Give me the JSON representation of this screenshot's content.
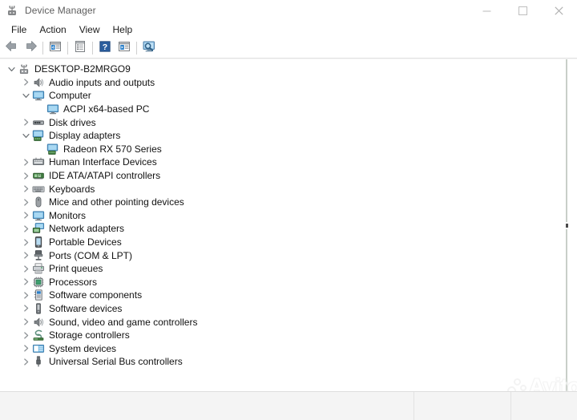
{
  "window": {
    "title": "Device Manager",
    "icon": "device-manager-icon",
    "controls": [
      {
        "name": "minimize-button",
        "glyph": "minimize"
      },
      {
        "name": "maximize-button",
        "glyph": "maximize"
      },
      {
        "name": "close-button",
        "glyph": "close"
      }
    ]
  },
  "menubar": {
    "items": [
      {
        "label": "File"
      },
      {
        "label": "Action"
      },
      {
        "label": "View"
      },
      {
        "label": "Help"
      }
    ]
  },
  "toolbar": {
    "buttons": [
      {
        "name": "back-button",
        "icon": "back-arrow-icon"
      },
      {
        "name": "forward-button",
        "icon": "forward-arrow-icon"
      },
      {
        "name": "separator-1",
        "icon": "separator"
      },
      {
        "name": "show-hide-console-tree-button",
        "icon": "console-tree-icon"
      },
      {
        "name": "separator-2",
        "icon": "separator"
      },
      {
        "name": "properties-button",
        "icon": "properties-icon"
      },
      {
        "name": "separator-3",
        "icon": "separator"
      },
      {
        "name": "help-button",
        "icon": "help-icon"
      },
      {
        "name": "update-driver-button",
        "icon": "update-driver-icon"
      },
      {
        "name": "separator-4",
        "icon": "separator"
      },
      {
        "name": "scan-for-hardware-changes-button",
        "icon": "scan-hardware-icon"
      }
    ]
  },
  "tree": {
    "nodes": [
      {
        "label": "DESKTOP-B2MRGO9",
        "depth": 0,
        "state": "expanded",
        "icon": "computer-root-icon"
      },
      {
        "label": "Audio inputs and outputs",
        "depth": 1,
        "state": "collapsed",
        "icon": "speaker-icon"
      },
      {
        "label": "Computer",
        "depth": 1,
        "state": "expanded",
        "icon": "monitor-icon"
      },
      {
        "label": "ACPI x64-based PC",
        "depth": 2,
        "state": "leaf",
        "icon": "monitor-icon"
      },
      {
        "label": "Disk drives",
        "depth": 1,
        "state": "collapsed",
        "icon": "disk-drive-icon"
      },
      {
        "label": "Display adapters",
        "depth": 1,
        "state": "expanded",
        "icon": "display-adapter-icon"
      },
      {
        "label": "Radeon RX 570 Series",
        "depth": 2,
        "state": "leaf",
        "icon": "display-adapter-icon"
      },
      {
        "label": "Human Interface Devices",
        "depth": 1,
        "state": "collapsed",
        "icon": "hid-icon"
      },
      {
        "label": "IDE ATA/ATAPI controllers",
        "depth": 1,
        "state": "collapsed",
        "icon": "ide-controller-icon"
      },
      {
        "label": "Keyboards",
        "depth": 1,
        "state": "collapsed",
        "icon": "keyboard-icon"
      },
      {
        "label": "Mice and other pointing devices",
        "depth": 1,
        "state": "collapsed",
        "icon": "mouse-icon"
      },
      {
        "label": "Monitors",
        "depth": 1,
        "state": "collapsed",
        "icon": "monitor-icon"
      },
      {
        "label": "Network adapters",
        "depth": 1,
        "state": "collapsed",
        "icon": "network-adapter-icon"
      },
      {
        "label": "Portable Devices",
        "depth": 1,
        "state": "collapsed",
        "icon": "portable-device-icon"
      },
      {
        "label": "Ports (COM & LPT)",
        "depth": 1,
        "state": "collapsed",
        "icon": "port-icon"
      },
      {
        "label": "Print queues",
        "depth": 1,
        "state": "collapsed",
        "icon": "printer-icon"
      },
      {
        "label": "Processors",
        "depth": 1,
        "state": "collapsed",
        "icon": "processor-icon"
      },
      {
        "label": "Software components",
        "depth": 1,
        "state": "collapsed",
        "icon": "software-component-icon"
      },
      {
        "label": "Software devices",
        "depth": 1,
        "state": "collapsed",
        "icon": "software-device-icon"
      },
      {
        "label": "Sound, video and game controllers",
        "depth": 1,
        "state": "collapsed",
        "icon": "speaker-icon"
      },
      {
        "label": "Storage controllers",
        "depth": 1,
        "state": "collapsed",
        "icon": "storage-controller-icon"
      },
      {
        "label": "System devices",
        "depth": 1,
        "state": "collapsed",
        "icon": "system-device-icon"
      },
      {
        "label": "Universal Serial Bus controllers",
        "depth": 1,
        "state": "collapsed",
        "icon": "usb-icon"
      }
    ]
  },
  "watermark": {
    "text": "Avito"
  },
  "colors": {
    "window_bg": "#ffffff",
    "title_text": "#5d5d5d",
    "menu_text": "#1b1b1b",
    "tree_text": "#111111",
    "statusbar_bg": "#f4f4f4",
    "accent_blue": "#2a7fc9",
    "chevron": "#7a7a7a"
  }
}
